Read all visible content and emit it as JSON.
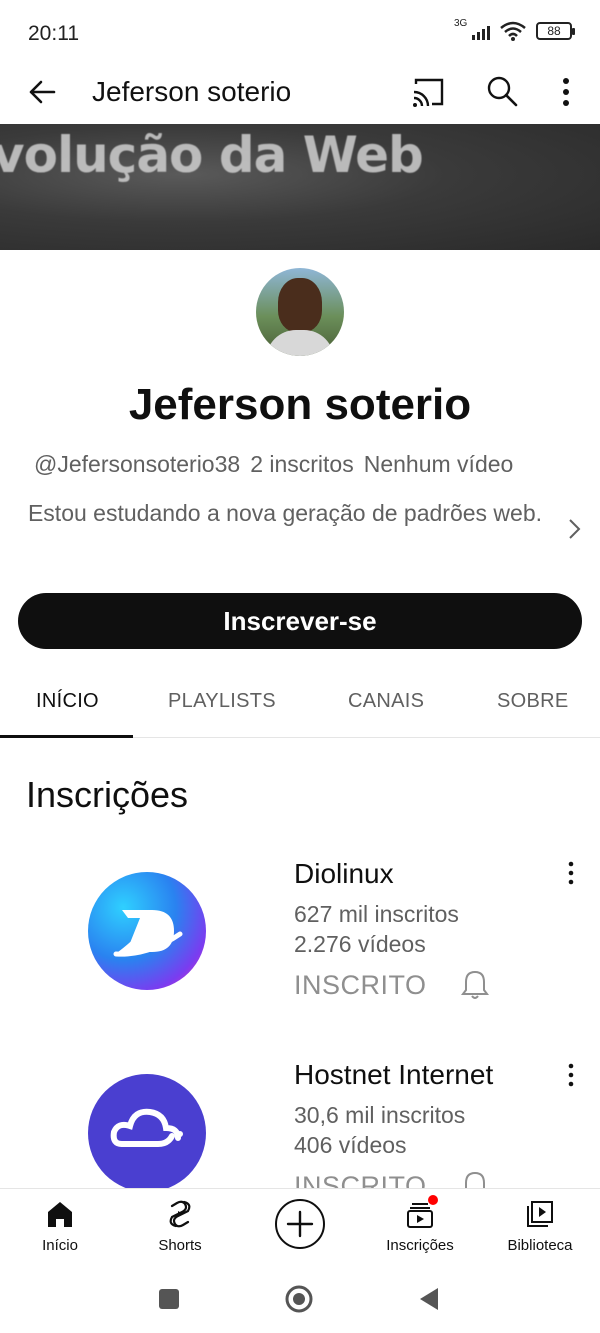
{
  "status_bar": {
    "time": "20:11",
    "network": "3G",
    "battery": "88"
  },
  "app_bar": {
    "title": "Jeferson soterio"
  },
  "banner": {
    "text": "volução da Web"
  },
  "channel": {
    "name": "Jeferson soterio",
    "handle": "@Jefersonsoterio38",
    "subscribers": "2 inscritos",
    "videos": "Nenhum vídeo",
    "description": "Estou estudando a nova geração de padrões web.",
    "subscribe_label": "Inscrever-se"
  },
  "tabs": [
    {
      "label": "INÍCIO",
      "active": true
    },
    {
      "label": "PLAYLISTS",
      "active": false
    },
    {
      "label": "CANAIS",
      "active": false
    },
    {
      "label": "SOBRE",
      "active": false
    }
  ],
  "section": {
    "title": "Inscrições"
  },
  "subscriptions": [
    {
      "name": "Diolinux",
      "subscribers": "627 mil inscritos",
      "videos": "2.276 vídeos",
      "status": "INSCRITO",
      "logo_color": "#2a82f0"
    },
    {
      "name": "Hostnet Internet",
      "subscribers": "30,6 mil inscritos",
      "videos": "406 vídeos",
      "status": "INSCRITO",
      "logo_color": "#4a3fd0"
    }
  ],
  "bottom_nav": [
    {
      "label": "Início",
      "icon": "home-icon"
    },
    {
      "label": "Shorts",
      "icon": "shorts-icon"
    },
    {
      "label": "",
      "icon": "create-icon"
    },
    {
      "label": "Inscrições",
      "icon": "subscriptions-icon"
    },
    {
      "label": "Biblioteca",
      "icon": "library-icon"
    }
  ]
}
